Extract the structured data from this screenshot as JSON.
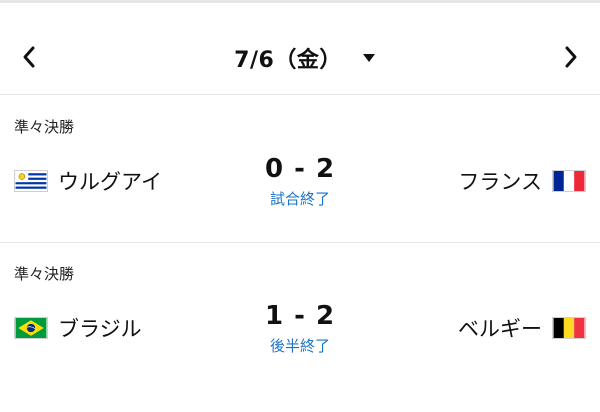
{
  "date_nav": {
    "date": "7/6（金）"
  },
  "matches": [
    {
      "round": "準々決勝",
      "home": {
        "name": "ウルグアイ",
        "flag": "uruguay-flag"
      },
      "away": {
        "name": "フランス",
        "flag": "france-flag"
      },
      "score": "0 - 2",
      "status": "試合終了"
    },
    {
      "round": "準々決勝",
      "home": {
        "name": "ブラジル",
        "flag": "brazil-flag"
      },
      "away": {
        "name": "ベルギー",
        "flag": "belgium-flag"
      },
      "score": "1 - 2",
      "status": "後半終了"
    }
  ],
  "colors": {
    "status_link": "#1a73c8",
    "divider": "#e3e3e3"
  }
}
